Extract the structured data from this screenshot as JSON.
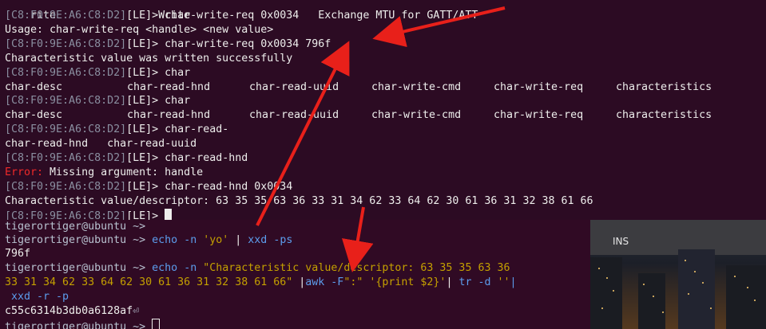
{
  "top_terminal": {
    "line0": {
      "a": "rite",
      "b": "Write",
      "c": "Exchange MTU for GATT/ATT"
    },
    "prompt_addr": "[C8:F0:9E:A6:C8:D2]",
    "prompt_mode": "[LE]>",
    "lines": [
      {
        "type": "prompt",
        "cmd": "char-write-req 0x0034"
      },
      {
        "type": "text",
        "text": "Usage: char-write-req <handle> <new value>"
      },
      {
        "type": "prompt",
        "cmd": "char-write-req 0x0034 796f"
      },
      {
        "type": "text",
        "text": "Characteristic value was written successfully"
      },
      {
        "type": "prompt",
        "cmd": "char"
      },
      {
        "type": "cols",
        "cols": [
          "char-desc",
          "char-read-hnd",
          "char-read-uuid",
          "char-write-cmd",
          "char-write-req",
          "characteristics"
        ]
      },
      {
        "type": "prompt",
        "cmd": "char"
      },
      {
        "type": "cols",
        "cols": [
          "char-desc",
          "char-read-hnd",
          "char-read-uuid",
          "char-write-cmd",
          "char-write-req",
          "characteristics"
        ]
      },
      {
        "type": "prompt",
        "cmd": "char-read-"
      },
      {
        "type": "text",
        "text": "char-read-hnd   char-read-uuid"
      },
      {
        "type": "prompt",
        "cmd": "char-read-hnd"
      },
      {
        "type": "error",
        "label": "Error:",
        "text": " Missing argument: handle"
      },
      {
        "type": "prompt",
        "cmd": "char-read-hnd 0x0034"
      },
      {
        "type": "text",
        "text": "Characteristic value/descriptor: 63 35 35 63 36 33 31 34 62 33 64 62 30 61 36 31 32 38 61 66"
      },
      {
        "type": "prompt",
        "cmd": ""
      }
    ]
  },
  "bottom_terminal": {
    "user": "tigerortiger@ubuntu",
    "path": " ~>",
    "l1_cmd": "",
    "l2_echo": "echo",
    "l2_flag": " -n ",
    "l2_str": "'yo'",
    "l2_pipe": " | ",
    "l2_xxd": "xxd",
    "l2_flag2": " -ps",
    "l3_out": "796f",
    "l4_echo": "echo",
    "l4_flag": " -n ",
    "l4_str": "\"Characteristic value/descriptor: 63 35 35 63 36",
    "l5_str": "33 31 34 62 33 64 62 30 61 36 31 32 38 61 66\"",
    "l5_pipe1": " |",
    "l5_awk": "awk",
    "l5_awkflag": " -F",
    "l5_sep": "\":\"",
    "l5_prog": " '{print $2}'",
    "l5_pipe2": "| ",
    "l5_tr": "tr",
    "l5_trflag": " -d ",
    "l5_trarg": "''",
    "l5_pipe3": "|",
    "l6_xxd": " xxd",
    "l6_flags": " -r -p",
    "l7_out": "c55c6314b3db0a6128af",
    "l7_mark": "⏎",
    "colors": {
      "accent_blue": "#5c9ded",
      "string_yellow": "#c4a000",
      "error_red": "#ef2929"
    }
  },
  "side_panel": {
    "label": "INS"
  },
  "annotations": {
    "arrow_color": "#e8201a"
  }
}
